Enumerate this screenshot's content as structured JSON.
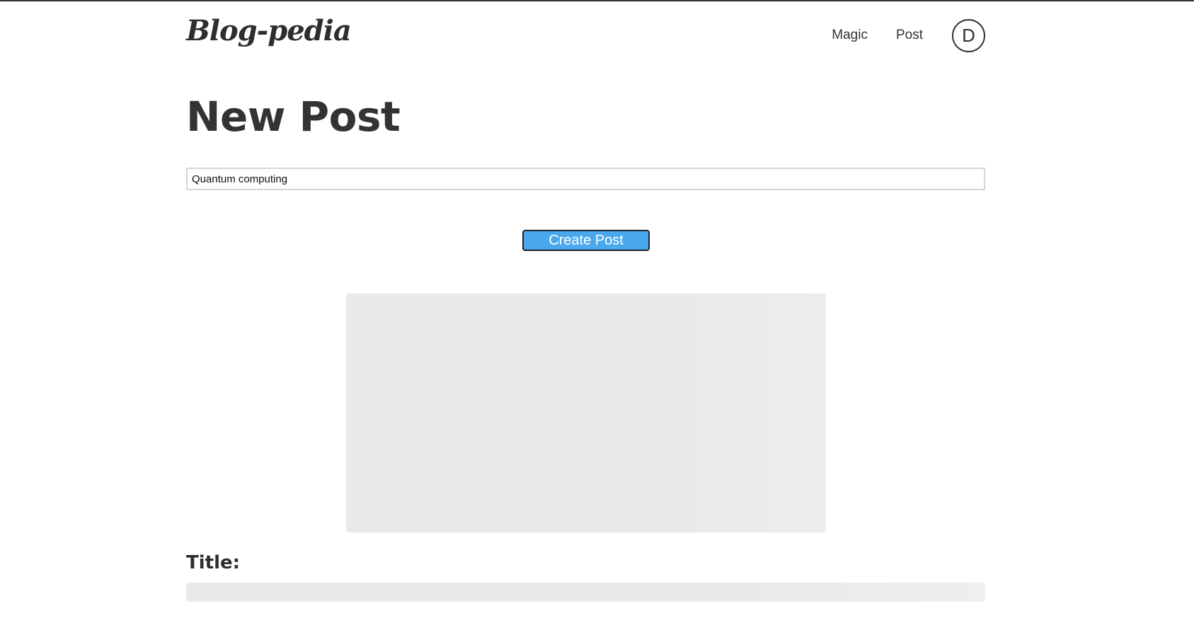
{
  "header": {
    "logo": "Blog-pedia",
    "nav": [
      {
        "label": "Magic"
      },
      {
        "label": "Post"
      }
    ],
    "avatar_initial": "D"
  },
  "main": {
    "page_title": "New Post",
    "topic_input": {
      "value": "Quantum computing"
    },
    "create_button_label": "Create Post",
    "title_label": "Title:"
  },
  "colors": {
    "accent": "#4aa8ee",
    "text": "#333333",
    "placeholder": "#e9e9e9"
  }
}
